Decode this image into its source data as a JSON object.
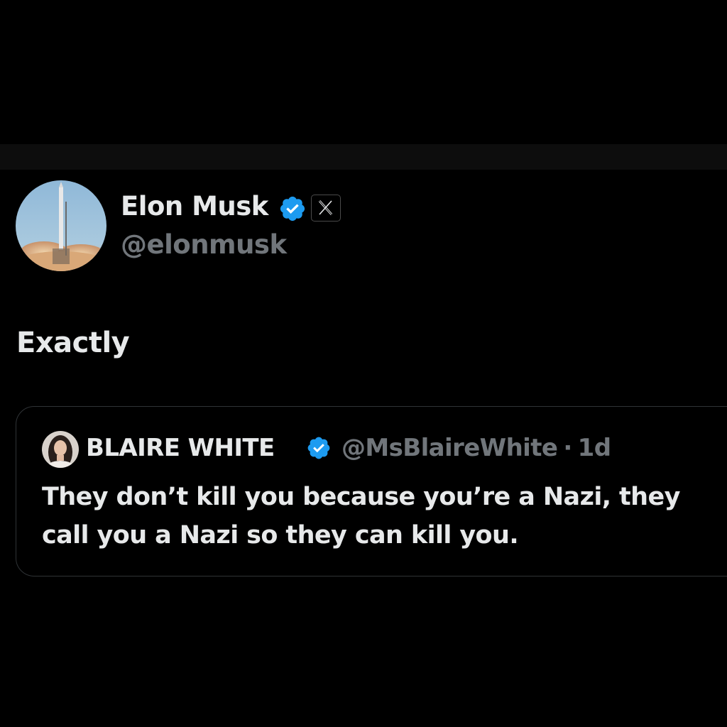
{
  "post": {
    "author": {
      "name": "Elon Musk",
      "handle": "@elonmusk",
      "avatar_icon": "rocket-launch-avatar",
      "verified_icon": "verified-badge-icon",
      "affiliation_icon": "x-logo-icon"
    },
    "text": "Exactly",
    "quoted": {
      "author": {
        "name": "BLAIRE WHITE",
        "handle": "@MsBlaireWhite",
        "separator": "·",
        "time": "1d",
        "avatar_icon": "profile-photo-avatar",
        "verified_icon": "verified-badge-icon"
      },
      "text": "They don’t kill you because you’re a Nazi, they call you a Nazi so they can kill you."
    }
  },
  "colors": {
    "background": "#000000",
    "primary_text": "#e7e9ea",
    "secondary_text": "#71767b",
    "verified_blue": "#1d9bf0",
    "border": "#2f3336"
  }
}
